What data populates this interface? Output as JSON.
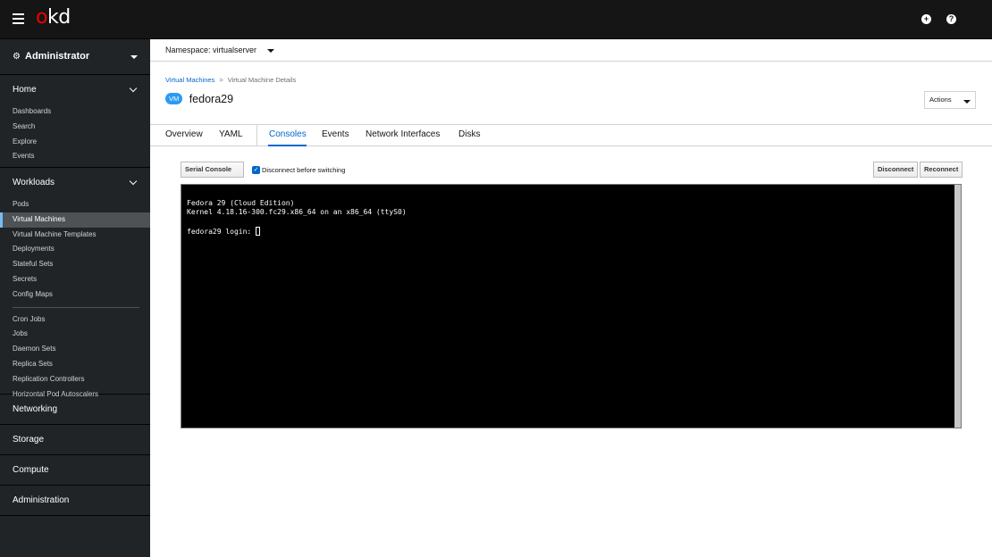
{
  "masthead": {
    "logo_prefix": "o",
    "logo_suffix": "kd",
    "add_icon": "plus-circle-icon",
    "help_icon": "question-circle-icon"
  },
  "sidebar": {
    "perspective": "Administrator",
    "home": {
      "title": "Home",
      "items": [
        "Dashboards",
        "Search",
        "Explore",
        "Events"
      ]
    },
    "workloads": {
      "title": "Workloads",
      "items": [
        "Pods",
        "Virtual Machines",
        "Virtual Machine Templates",
        "Deployments",
        "Stateful Sets",
        "Secrets",
        "Config Maps"
      ],
      "items2": [
        "Cron Jobs",
        "Jobs",
        "Daemon Sets",
        "Replica Sets",
        "Replication Controllers",
        "Horizontal Pod Autoscalers"
      ],
      "active": "Virtual Machines"
    },
    "collapsed": [
      "Networking",
      "Storage",
      "Compute",
      "Administration"
    ]
  },
  "namespace": {
    "label": "Namespace: virtualserver"
  },
  "breadcrumb": {
    "parent": "Virtual Machines",
    "sep": ">",
    "current": "Virtual Machine Details"
  },
  "title": {
    "badge": "VM",
    "name": "fedora29"
  },
  "actions": {
    "label": "Actions"
  },
  "tabs": [
    "Overview",
    "YAML",
    "Consoles",
    "Events",
    "Network Interfaces",
    "Disks"
  ],
  "active_tab": "Consoles",
  "console": {
    "type_label": "Serial Console",
    "disconnect_checkbox_label": "Disconnect before switching",
    "disconnect_checked": true,
    "disconnect_button": "Disconnect",
    "reconnect_button": "Reconnect",
    "lines": [
      "Fedora 29 (Cloud Edition)",
      "Kernel 4.18.16-300.fc29.x86_64 on an x86_64 (ttyS0)",
      "",
      "fedora29 login: "
    ]
  }
}
